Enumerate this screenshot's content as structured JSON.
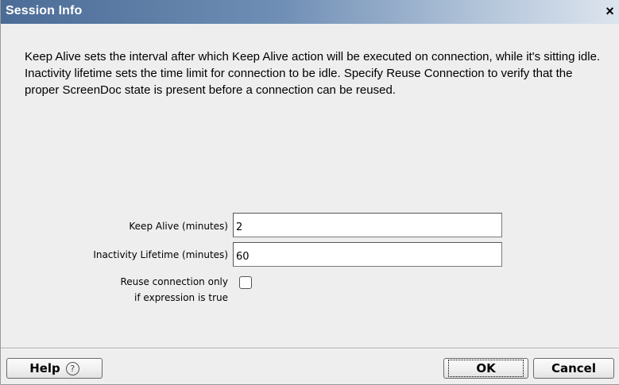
{
  "window": {
    "title": "Session Info",
    "close_glyph": "×"
  },
  "description": "Keep Alive sets the interval after which Keep Alive action will be executed on connection, while it's sitting idle. Inactivity lifetime sets the time limit for connection to be idle. Specify Reuse Connection to verify that the proper ScreenDoc state is present before a connection can be reused.",
  "form": {
    "keep_alive_label": "Keep Alive (minutes)",
    "keep_alive_value": "2",
    "inactivity_label": "Inactivity Lifetime (minutes)",
    "inactivity_value": "60",
    "reuse_label_line1": "Reuse connection only",
    "reuse_label_line2": "if expression is true",
    "reuse_checked": false
  },
  "buttons": {
    "help_label": "Help",
    "help_icon_glyph": "?",
    "ok_label": "OK",
    "cancel_label": "Cancel"
  },
  "icons": {
    "close": "close-icon",
    "help": "help-circle-icon"
  },
  "colors": {
    "titlebar_start": "#4b6c96",
    "titlebar_end": "#dde5ee",
    "dialog_bg": "#eeeeee"
  }
}
